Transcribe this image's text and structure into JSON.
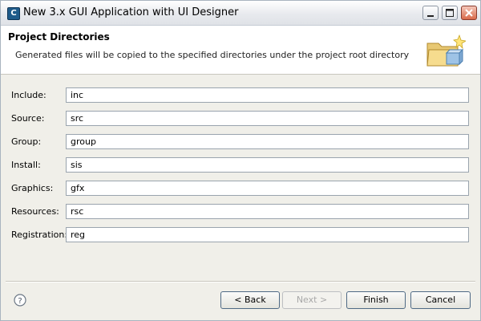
{
  "window": {
    "title": "New 3.x GUI Application with UI Designer",
    "app_icon_letter": "C"
  },
  "header": {
    "title": "Project Directories",
    "description": "Generated files will be copied to the specified directories under the project root directory",
    "banner_icon": "folder-new-icon"
  },
  "fields": [
    {
      "label": "Include:",
      "value": "inc"
    },
    {
      "label": "Source:",
      "value": "src"
    },
    {
      "label": "Group:",
      "value": "group"
    },
    {
      "label": "Install:",
      "value": "sis"
    },
    {
      "label": "Graphics:",
      "value": "gfx"
    },
    {
      "label": "Resources:",
      "value": "rsc"
    },
    {
      "label": "Registration:",
      "value": "reg"
    }
  ],
  "buttons": {
    "back": "< Back",
    "next": "Next >",
    "finish": "Finish",
    "cancel": "Cancel",
    "next_enabled": false
  },
  "colors": {
    "dialog_bg": "#f0efe9",
    "header_bg": "#ffffff",
    "close_button": "#d96a4a"
  }
}
